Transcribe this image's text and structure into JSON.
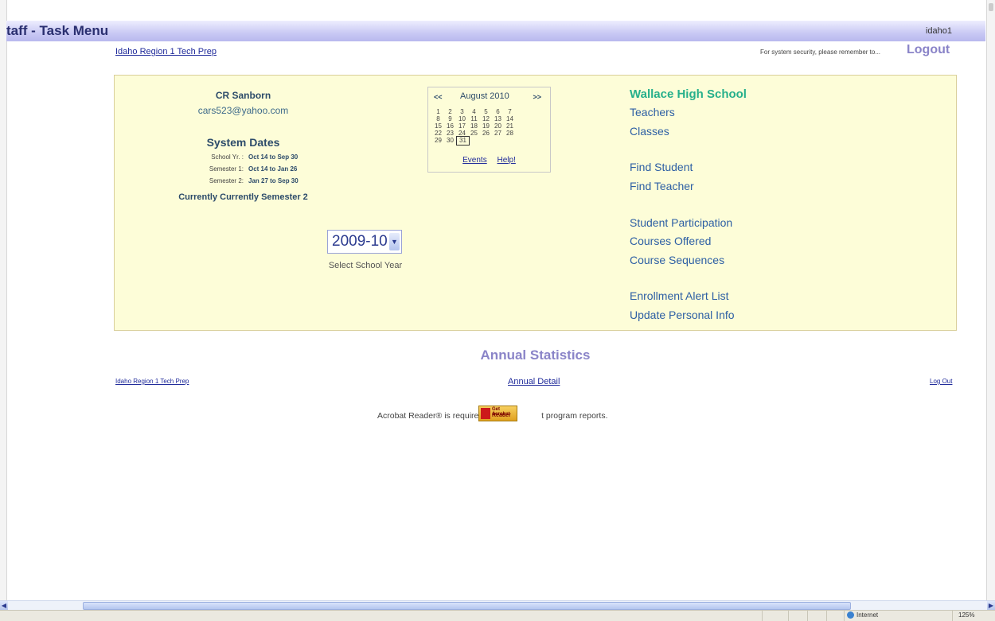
{
  "header": {
    "title": "taff - Task Menu",
    "user": "idaho1"
  },
  "top": {
    "site_link": "Idaho Region 1 Tech Prep",
    "security_note": "For system security, please remember to...",
    "logout": "Logout"
  },
  "user": {
    "name": "CR Sanborn",
    "email": "cars523@yahoo.com"
  },
  "system_dates": {
    "title": "System Dates",
    "rows": [
      {
        "label": "School Yr. :",
        "value": "Oct 14 to Sep 30"
      },
      {
        "label": "Semester 1:",
        "value": "Oct 14 to Jan 26"
      },
      {
        "label": "Semester 2:",
        "value": "Jan 27 to Sep 30"
      }
    ],
    "current": "Currently Currently Semester 2"
  },
  "calendar": {
    "prev": "<<",
    "month": "August 2010",
    "next": ">>",
    "weeks": [
      [
        "1",
        "2",
        "3",
        "4",
        "5",
        "6",
        "7"
      ],
      [
        "8",
        "9",
        "10",
        "11",
        "12",
        "13",
        "14"
      ],
      [
        "15",
        "16",
        "17",
        "18",
        "19",
        "20",
        "21"
      ],
      [
        "22",
        "23",
        "24",
        "25",
        "26",
        "27",
        "28"
      ],
      [
        "29",
        "30",
        "31"
      ]
    ],
    "today": "31",
    "events_link": "Events",
    "help_link": "Help!"
  },
  "school_year": {
    "value": "2009-10",
    "label": "Select School Year"
  },
  "menu": {
    "school": "Wallace High School",
    "items": [
      "Teachers",
      "Classes",
      "Find Student",
      "Find Teacher",
      "Student Participation",
      "Courses Offered",
      "Course Sequences",
      "Enrollment Alert List",
      "Update Personal Info"
    ]
  },
  "annual": {
    "title": "Annual Statistics"
  },
  "footer": {
    "left_link": "Idaho Region 1 Tech Prep",
    "mid_link": "Annual Detail",
    "right_link": "Log Out",
    "acrobat_before": "Acrobat Reader® is required to  v",
    "acrobat_after": "t program reports.",
    "acrobat_badge_top": "Get Acrobat",
    "acrobat_badge_bottom": "Reader"
  },
  "statusbar": {
    "zone": "Internet",
    "zoom": "125%"
  }
}
